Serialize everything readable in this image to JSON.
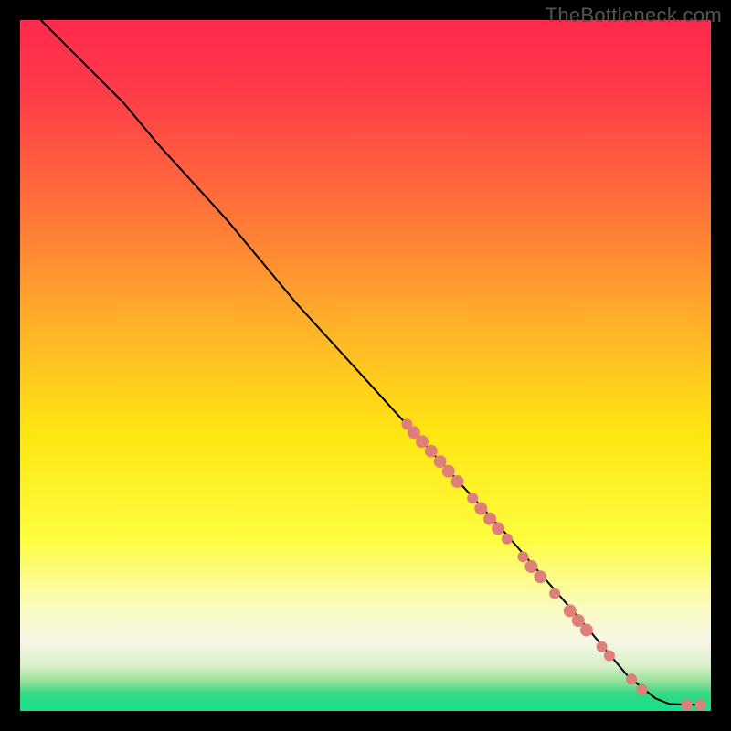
{
  "watermark": "TheBottleneck.com",
  "chart_data": {
    "type": "line",
    "title": "",
    "xlabel": "",
    "ylabel": "",
    "xlim": [
      0,
      100
    ],
    "ylim": [
      0,
      100
    ],
    "gradient_stops": [
      {
        "offset": 0.0,
        "color": "#ff2a4d"
      },
      {
        "offset": 0.1,
        "color": "#ff3a49"
      },
      {
        "offset": 0.25,
        "color": "#ff6a3c"
      },
      {
        "offset": 0.45,
        "color": "#ffb428"
      },
      {
        "offset": 0.6,
        "color": "#ffe612"
      },
      {
        "offset": 0.75,
        "color": "#fdfd3e"
      },
      {
        "offset": 0.85,
        "color": "#fbfbbf"
      },
      {
        "offset": 0.9,
        "color": "#f6f6e7"
      },
      {
        "offset": 0.935,
        "color": "#d8efc9"
      },
      {
        "offset": 0.955,
        "color": "#9fe29e"
      },
      {
        "offset": 0.975,
        "color": "#34d884"
      },
      {
        "offset": 1.0,
        "color": "#17e08a"
      }
    ],
    "curve": [
      {
        "x": 3,
        "y": 100
      },
      {
        "x": 6,
        "y": 97
      },
      {
        "x": 10,
        "y": 93
      },
      {
        "x": 15,
        "y": 88
      },
      {
        "x": 20,
        "y": 82
      },
      {
        "x": 30,
        "y": 71
      },
      {
        "x": 40,
        "y": 59
      },
      {
        "x": 50,
        "y": 48
      },
      {
        "x": 60,
        "y": 37
      },
      {
        "x": 70,
        "y": 26
      },
      {
        "x": 80,
        "y": 14.5
      },
      {
        "x": 88,
        "y": 5
      },
      {
        "x": 92,
        "y": 1.8
      },
      {
        "x": 94,
        "y": 1.0
      },
      {
        "x": 97,
        "y": 0.9
      },
      {
        "x": 99,
        "y": 0.9
      }
    ],
    "series": [
      {
        "name": "markers",
        "type": "scatter",
        "color": "#df7f7a",
        "points": [
          {
            "x": 56.0,
            "y": 41.5,
            "r": 6
          },
          {
            "x": 57.0,
            "y": 40.3,
            "r": 7
          },
          {
            "x": 58.2,
            "y": 39.0,
            "r": 7
          },
          {
            "x": 59.5,
            "y": 37.6,
            "r": 7
          },
          {
            "x": 60.8,
            "y": 36.1,
            "r": 7
          },
          {
            "x": 62.0,
            "y": 34.7,
            "r": 7
          },
          {
            "x": 63.3,
            "y": 33.2,
            "r": 7
          },
          {
            "x": 65.5,
            "y": 30.8,
            "r": 6
          },
          {
            "x": 66.7,
            "y": 29.3,
            "r": 7
          },
          {
            "x": 68.0,
            "y": 27.8,
            "r": 7
          },
          {
            "x": 69.2,
            "y": 26.4,
            "r": 7
          },
          {
            "x": 70.5,
            "y": 24.9,
            "r": 6
          },
          {
            "x": 72.8,
            "y": 22.3,
            "r": 6
          },
          {
            "x": 74.0,
            "y": 20.9,
            "r": 7
          },
          {
            "x": 75.3,
            "y": 19.4,
            "r": 7
          },
          {
            "x": 77.4,
            "y": 17.0,
            "r": 6
          },
          {
            "x": 79.6,
            "y": 14.5,
            "r": 7
          },
          {
            "x": 80.8,
            "y": 13.1,
            "r": 7
          },
          {
            "x": 82.0,
            "y": 11.7,
            "r": 7
          },
          {
            "x": 84.2,
            "y": 9.3,
            "r": 6
          },
          {
            "x": 85.3,
            "y": 8.0,
            "r": 6
          },
          {
            "x": 88.5,
            "y": 4.6,
            "r": 6
          },
          {
            "x": 90.0,
            "y": 3.1,
            "r": 6
          },
          {
            "x": 96.5,
            "y": 0.9,
            "r": 6
          },
          {
            "x": 98.5,
            "y": 0.9,
            "r": 6
          }
        ]
      }
    ]
  }
}
